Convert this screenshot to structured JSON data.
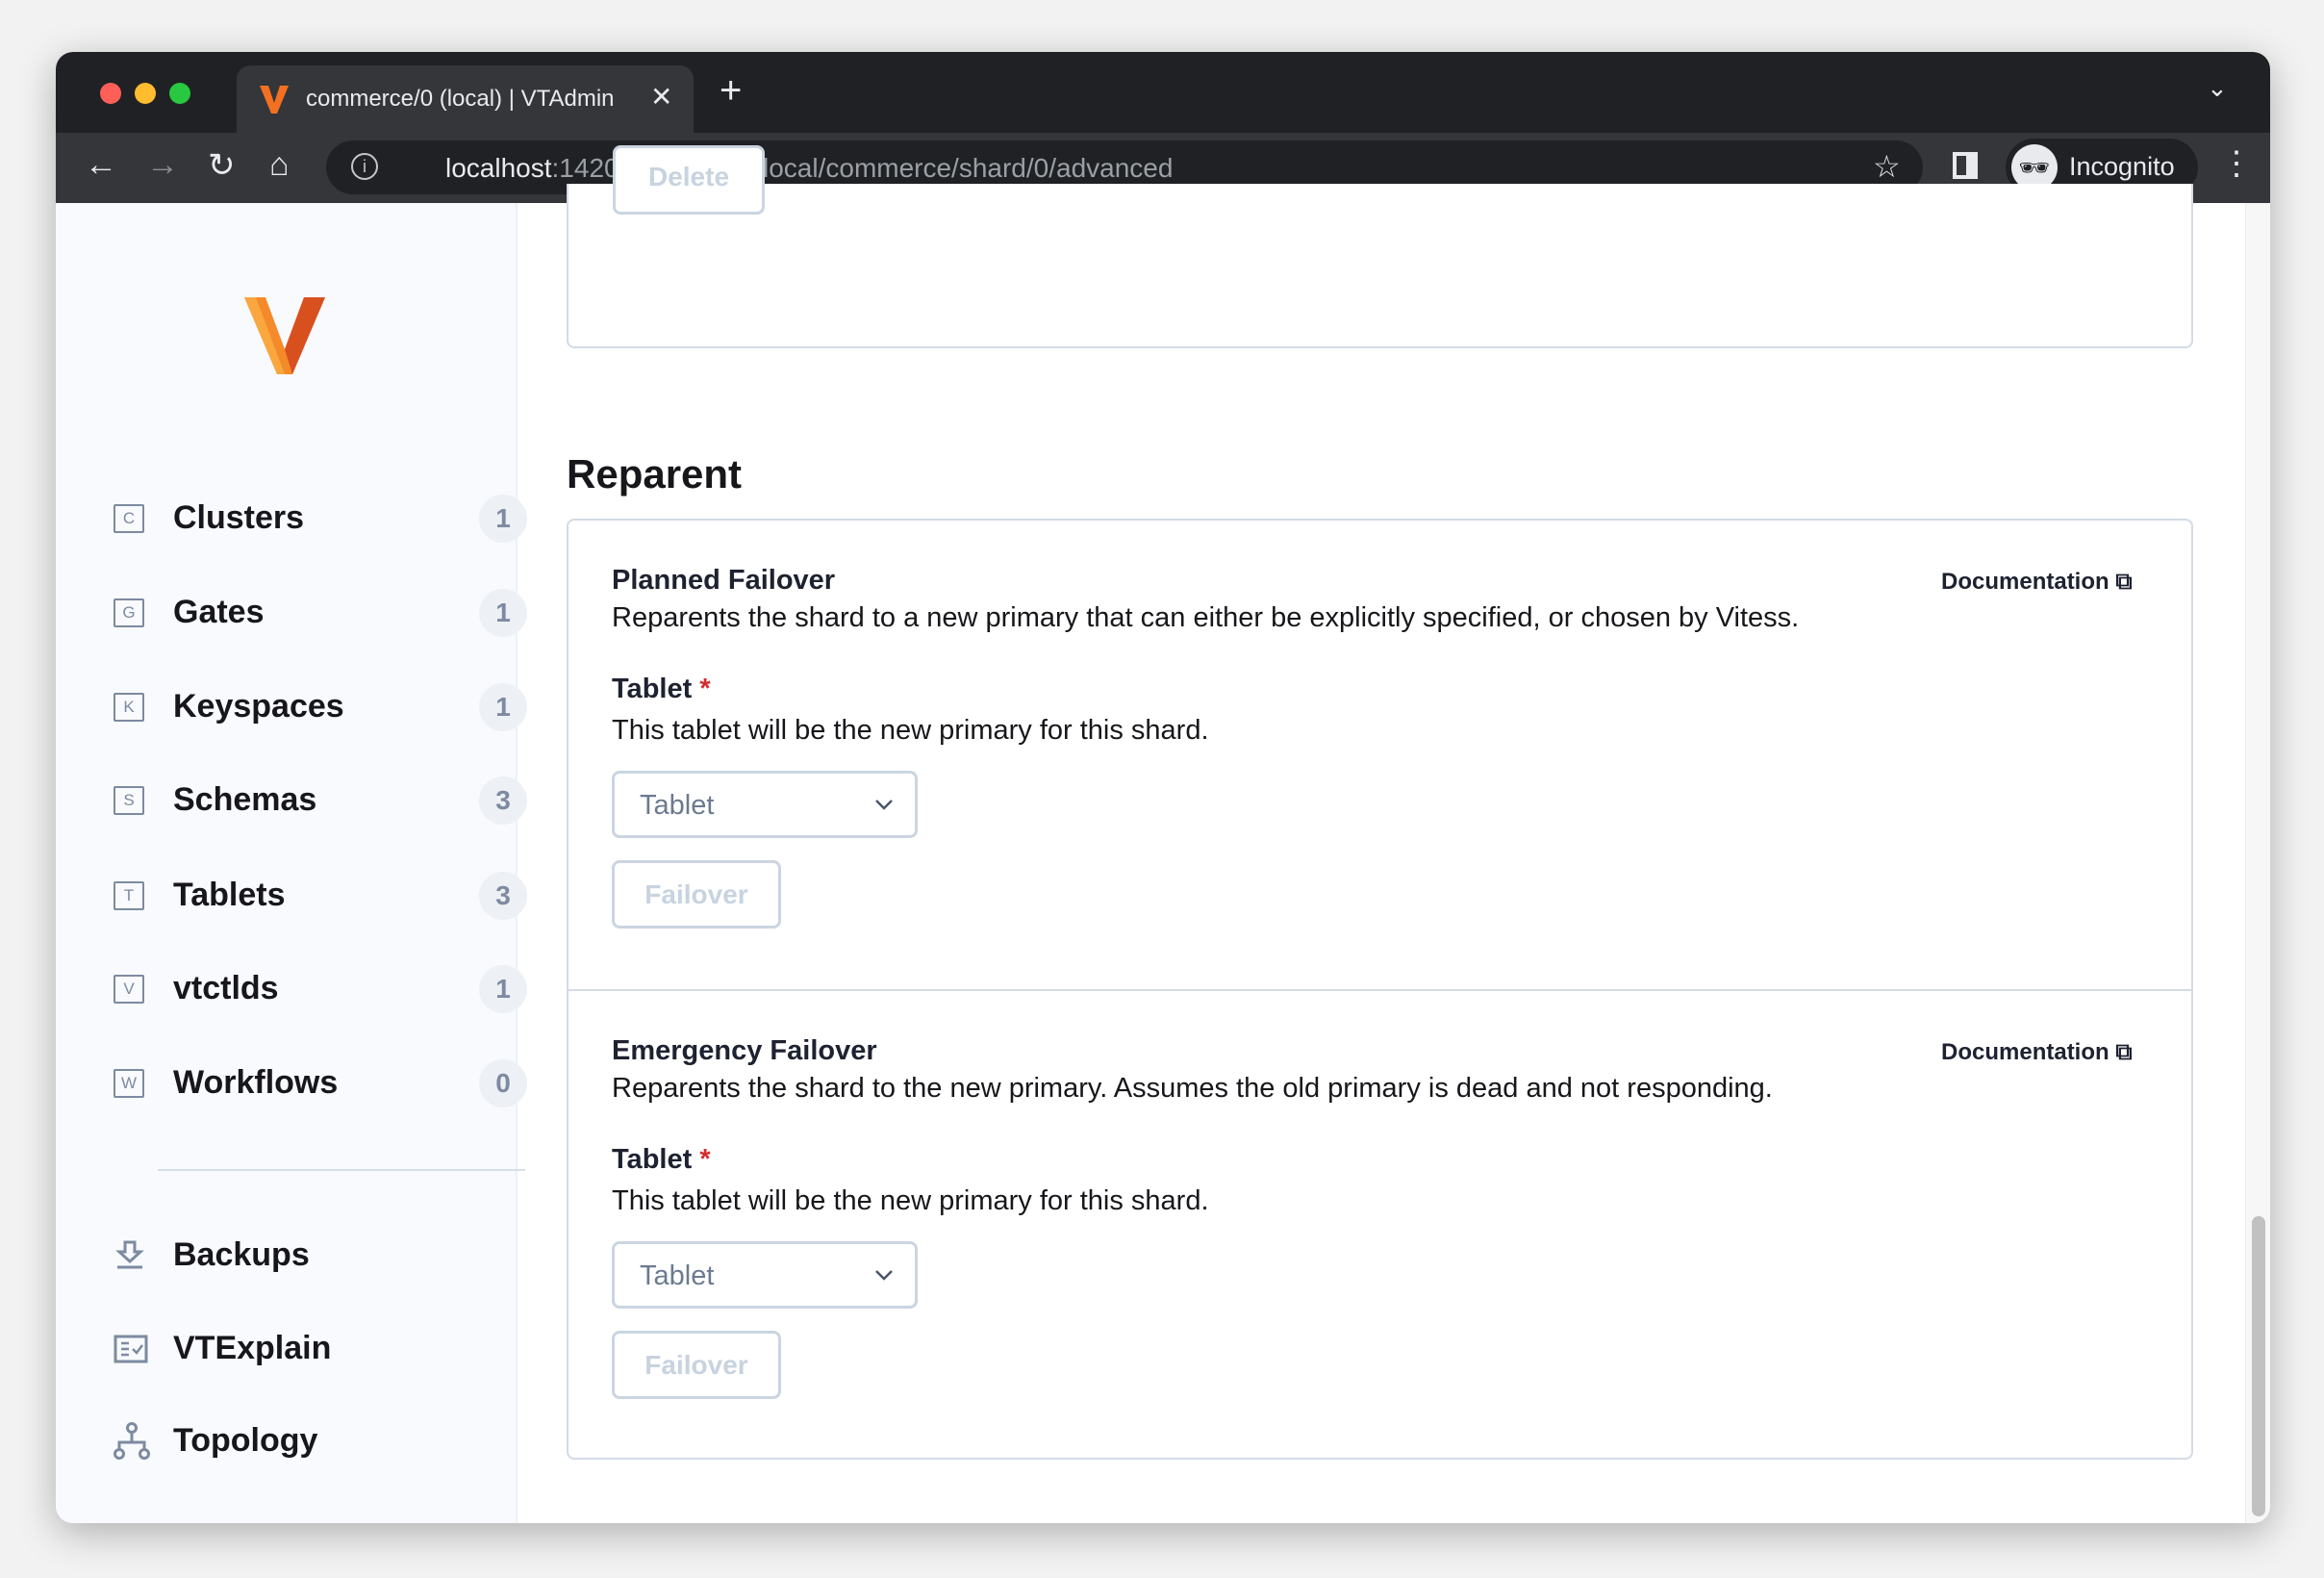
{
  "browser": {
    "tab_title": "commerce/0 (local) | VTAdmin",
    "url_host": "localhost",
    "url_path": ":14201/keyspace/local/commerce/shard/0/advanced",
    "profile_label": "Incognito"
  },
  "sidebar": {
    "items": [
      {
        "icon": "C",
        "label": "Clusters",
        "count": "1"
      },
      {
        "icon": "G",
        "label": "Gates",
        "count": "1"
      },
      {
        "icon": "K",
        "label": "Keyspaces",
        "count": "1"
      },
      {
        "icon": "S",
        "label": "Schemas",
        "count": "3"
      },
      {
        "icon": "T",
        "label": "Tablets",
        "count": "3"
      },
      {
        "icon": "V",
        "label": "vtctlds",
        "count": "1"
      },
      {
        "icon": "W",
        "label": "Workflows",
        "count": "0"
      }
    ],
    "tools": [
      {
        "icon": "download-icon",
        "label": "Backups"
      },
      {
        "icon": "explain-icon",
        "label": "VTExplain"
      },
      {
        "icon": "topology-icon",
        "label": "Topology"
      }
    ]
  },
  "main": {
    "prev_button_label": "Delete",
    "section_title": "Reparent",
    "cards": [
      {
        "title": "Planned Failover",
        "description": "Reparents the shard to a new primary that can either be explicitly specified, or chosen by Vitess.",
        "doc_label": "Documentation",
        "field_label": "Tablet",
        "required": "*",
        "field_help": "This tablet will be the new primary for this shard.",
        "select_placeholder": "Tablet",
        "button_label": "Failover"
      },
      {
        "title": "Emergency Failover",
        "description": "Reparents the shard to the new primary. Assumes the old primary is dead and not responding.",
        "doc_label": "Documentation",
        "field_label": "Tablet",
        "required": "*",
        "field_help": "This tablet will be the new primary for this shard.",
        "select_placeholder": "Tablet",
        "button_label": "Failover"
      }
    ]
  },
  "colors": {
    "brand": "#f37021",
    "required": "#d22d2d",
    "border": "#d3dbe6"
  }
}
